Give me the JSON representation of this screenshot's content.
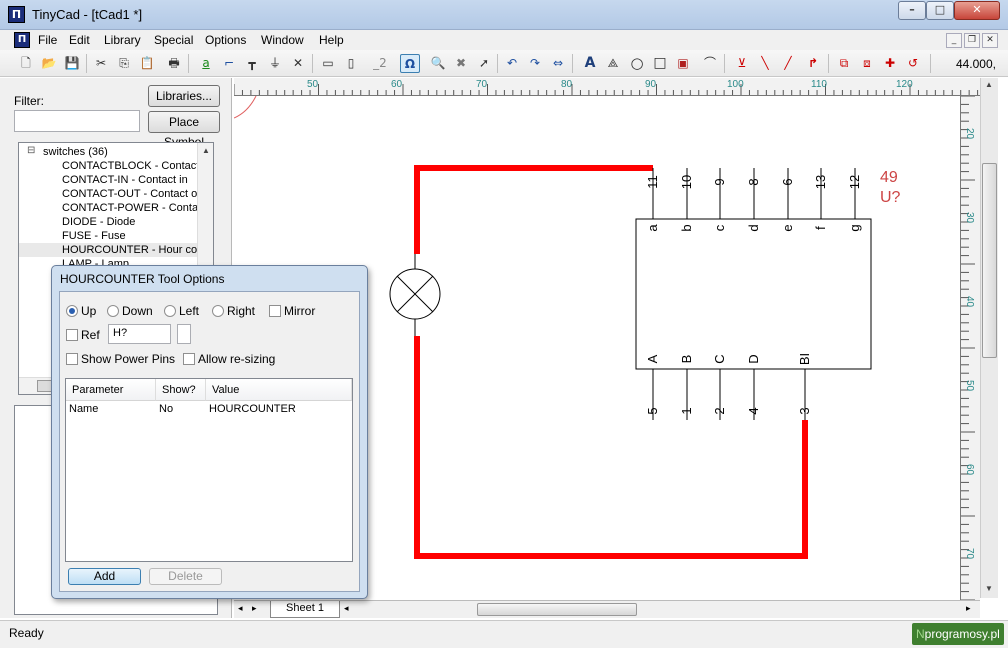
{
  "window": {
    "title": "TinyCad - [tCad1 *]",
    "app_icon": "tinycad-icon",
    "min": "–",
    "max": "□",
    "close": "✕"
  },
  "menu": [
    "File",
    "Edit",
    "Library",
    "Special",
    "Options",
    "Window",
    "Help"
  ],
  "toolbar": {
    "zoom": "44.000,"
  },
  "library_panel": {
    "filter_label": "Filter:",
    "filter_value": "",
    "libraries_button": "Libraries...",
    "place_symbol_button": "Place Symbol",
    "tree_root": "switches (36)",
    "tree_toggle": "⊟",
    "items": [
      "CONTACTBLOCK - Contactb",
      "CONTACT-IN - Contact in",
      "CONTACT-OUT - Contact ou",
      "CONTACT-POWER - Contac",
      "DIODE - Diode",
      "FUSE - Fuse",
      "HOURCOUNTER - Hour cour",
      "LAMP - Lamp"
    ],
    "selected_index": 6
  },
  "ruler": {
    "top_labels": [
      "50",
      "60",
      "70",
      "80",
      "90",
      "100",
      "110",
      "120"
    ],
    "right_labels": [
      "20",
      "30",
      "40",
      "50",
      "60",
      "70"
    ]
  },
  "schematic": {
    "pin_numbers_top": [
      "11",
      "10",
      "9",
      "8",
      "6",
      "13",
      "12"
    ],
    "pin_names_top": [
      "a",
      "b",
      "c",
      "d",
      "e",
      "f",
      "g"
    ],
    "pin_names_bottom": [
      "A",
      "B",
      "C",
      "D",
      "BI"
    ],
    "pin_numbers_bottom": [
      "5",
      "1",
      "2",
      "4",
      "3"
    ],
    "ref_number": "49",
    "ref_label": "U?",
    "wire_color": "#ff0000",
    "symbol_color": "#000000",
    "ref_color": "#cc4444"
  },
  "dialog": {
    "title": "HOURCOUNTER Tool Options",
    "orientation": {
      "up": "Up",
      "down": "Down",
      "left": "Left",
      "right": "Right",
      "selected": "up"
    },
    "mirror_label": "Mirror",
    "ref_label": "Ref",
    "ref_value": "H?",
    "show_power_pins": "Show Power Pins",
    "allow_resizing": "Allow re-sizing",
    "columns": [
      "Parameter",
      "Show?",
      "Value"
    ],
    "rows": [
      {
        "parameter": "Name",
        "show": "No",
        "value": "HOURCOUNTER"
      }
    ],
    "add_button": "Add",
    "delete_button": "Delete"
  },
  "sheets": {
    "active": "Sheet 1"
  },
  "status": {
    "text": "Ready",
    "watermark_part1": "N",
    "watermark_part2": "programosy.pl"
  }
}
